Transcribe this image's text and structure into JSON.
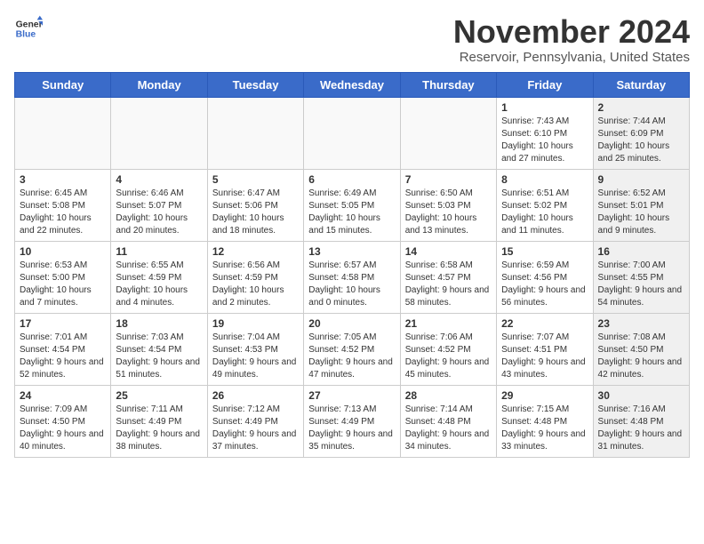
{
  "header": {
    "logo_general": "General",
    "logo_blue": "Blue",
    "month_title": "November 2024",
    "location": "Reservoir, Pennsylvania, United States"
  },
  "weekdays": [
    "Sunday",
    "Monday",
    "Tuesday",
    "Wednesday",
    "Thursday",
    "Friday",
    "Saturday"
  ],
  "weeks": [
    [
      {
        "day": "",
        "info": "",
        "empty": true
      },
      {
        "day": "",
        "info": "",
        "empty": true
      },
      {
        "day": "",
        "info": "",
        "empty": true
      },
      {
        "day": "",
        "info": "",
        "empty": true
      },
      {
        "day": "",
        "info": "",
        "empty": true
      },
      {
        "day": "1",
        "info": "Sunrise: 7:43 AM\nSunset: 6:10 PM\nDaylight: 10 hours and 27 minutes.",
        "empty": false,
        "shaded": false
      },
      {
        "day": "2",
        "info": "Sunrise: 7:44 AM\nSunset: 6:09 PM\nDaylight: 10 hours and 25 minutes.",
        "empty": false,
        "shaded": true
      }
    ],
    [
      {
        "day": "3",
        "info": "Sunrise: 6:45 AM\nSunset: 5:08 PM\nDaylight: 10 hours and 22 minutes.",
        "empty": false,
        "shaded": false
      },
      {
        "day": "4",
        "info": "Sunrise: 6:46 AM\nSunset: 5:07 PM\nDaylight: 10 hours and 20 minutes.",
        "empty": false,
        "shaded": false
      },
      {
        "day": "5",
        "info": "Sunrise: 6:47 AM\nSunset: 5:06 PM\nDaylight: 10 hours and 18 minutes.",
        "empty": false,
        "shaded": false
      },
      {
        "day": "6",
        "info": "Sunrise: 6:49 AM\nSunset: 5:05 PM\nDaylight: 10 hours and 15 minutes.",
        "empty": false,
        "shaded": false
      },
      {
        "day": "7",
        "info": "Sunrise: 6:50 AM\nSunset: 5:03 PM\nDaylight: 10 hours and 13 minutes.",
        "empty": false,
        "shaded": false
      },
      {
        "day": "8",
        "info": "Sunrise: 6:51 AM\nSunset: 5:02 PM\nDaylight: 10 hours and 11 minutes.",
        "empty": false,
        "shaded": false
      },
      {
        "day": "9",
        "info": "Sunrise: 6:52 AM\nSunset: 5:01 PM\nDaylight: 10 hours and 9 minutes.",
        "empty": false,
        "shaded": true
      }
    ],
    [
      {
        "day": "10",
        "info": "Sunrise: 6:53 AM\nSunset: 5:00 PM\nDaylight: 10 hours and 7 minutes.",
        "empty": false,
        "shaded": false
      },
      {
        "day": "11",
        "info": "Sunrise: 6:55 AM\nSunset: 4:59 PM\nDaylight: 10 hours and 4 minutes.",
        "empty": false,
        "shaded": false
      },
      {
        "day": "12",
        "info": "Sunrise: 6:56 AM\nSunset: 4:59 PM\nDaylight: 10 hours and 2 minutes.",
        "empty": false,
        "shaded": false
      },
      {
        "day": "13",
        "info": "Sunrise: 6:57 AM\nSunset: 4:58 PM\nDaylight: 10 hours and 0 minutes.",
        "empty": false,
        "shaded": false
      },
      {
        "day": "14",
        "info": "Sunrise: 6:58 AM\nSunset: 4:57 PM\nDaylight: 9 hours and 58 minutes.",
        "empty": false,
        "shaded": false
      },
      {
        "day": "15",
        "info": "Sunrise: 6:59 AM\nSunset: 4:56 PM\nDaylight: 9 hours and 56 minutes.",
        "empty": false,
        "shaded": false
      },
      {
        "day": "16",
        "info": "Sunrise: 7:00 AM\nSunset: 4:55 PM\nDaylight: 9 hours and 54 minutes.",
        "empty": false,
        "shaded": true
      }
    ],
    [
      {
        "day": "17",
        "info": "Sunrise: 7:01 AM\nSunset: 4:54 PM\nDaylight: 9 hours and 52 minutes.",
        "empty": false,
        "shaded": false
      },
      {
        "day": "18",
        "info": "Sunrise: 7:03 AM\nSunset: 4:54 PM\nDaylight: 9 hours and 51 minutes.",
        "empty": false,
        "shaded": false
      },
      {
        "day": "19",
        "info": "Sunrise: 7:04 AM\nSunset: 4:53 PM\nDaylight: 9 hours and 49 minutes.",
        "empty": false,
        "shaded": false
      },
      {
        "day": "20",
        "info": "Sunrise: 7:05 AM\nSunset: 4:52 PM\nDaylight: 9 hours and 47 minutes.",
        "empty": false,
        "shaded": false
      },
      {
        "day": "21",
        "info": "Sunrise: 7:06 AM\nSunset: 4:52 PM\nDaylight: 9 hours and 45 minutes.",
        "empty": false,
        "shaded": false
      },
      {
        "day": "22",
        "info": "Sunrise: 7:07 AM\nSunset: 4:51 PM\nDaylight: 9 hours and 43 minutes.",
        "empty": false,
        "shaded": false
      },
      {
        "day": "23",
        "info": "Sunrise: 7:08 AM\nSunset: 4:50 PM\nDaylight: 9 hours and 42 minutes.",
        "empty": false,
        "shaded": true
      }
    ],
    [
      {
        "day": "24",
        "info": "Sunrise: 7:09 AM\nSunset: 4:50 PM\nDaylight: 9 hours and 40 minutes.",
        "empty": false,
        "shaded": false
      },
      {
        "day": "25",
        "info": "Sunrise: 7:11 AM\nSunset: 4:49 PM\nDaylight: 9 hours and 38 minutes.",
        "empty": false,
        "shaded": false
      },
      {
        "day": "26",
        "info": "Sunrise: 7:12 AM\nSunset: 4:49 PM\nDaylight: 9 hours and 37 minutes.",
        "empty": false,
        "shaded": false
      },
      {
        "day": "27",
        "info": "Sunrise: 7:13 AM\nSunset: 4:49 PM\nDaylight: 9 hours and 35 minutes.",
        "empty": false,
        "shaded": false
      },
      {
        "day": "28",
        "info": "Sunrise: 7:14 AM\nSunset: 4:48 PM\nDaylight: 9 hours and 34 minutes.",
        "empty": false,
        "shaded": false
      },
      {
        "day": "29",
        "info": "Sunrise: 7:15 AM\nSunset: 4:48 PM\nDaylight: 9 hours and 33 minutes.",
        "empty": false,
        "shaded": false
      },
      {
        "day": "30",
        "info": "Sunrise: 7:16 AM\nSunset: 4:48 PM\nDaylight: 9 hours and 31 minutes.",
        "empty": false,
        "shaded": true
      }
    ]
  ]
}
